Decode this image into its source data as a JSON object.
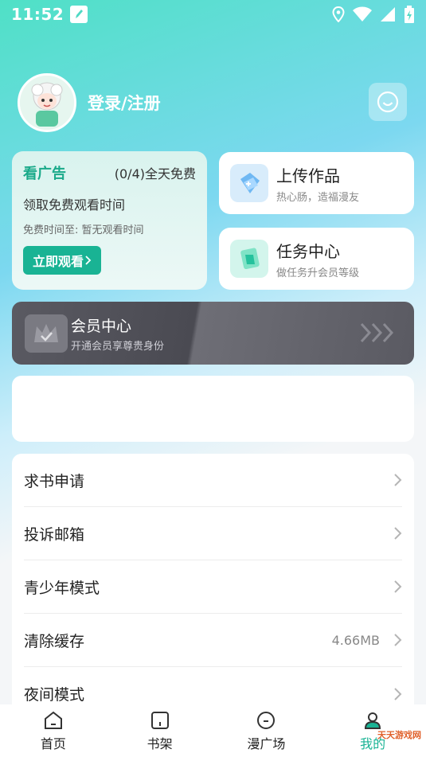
{
  "status_bar": {
    "time": "11:52"
  },
  "profile": {
    "login_label": "登录/注册",
    "avatar_badge": "小肥羊"
  },
  "ad_card": {
    "title": "看广告",
    "count": "(0/4)全天免费",
    "line1": "领取免费观看时间",
    "line2": "免费时间至: 暂无观看时间",
    "button": "立即观看"
  },
  "upload_card": {
    "title": "上传作品",
    "subtitle": "热心肠，造福漫友"
  },
  "task_card": {
    "title": "任务中心",
    "subtitle": "做任务升会员等级"
  },
  "vip_card": {
    "title": "会员中心",
    "subtitle": "开通会员享尊贵身份"
  },
  "menu": {
    "items": [
      {
        "label": "求书申请",
        "value": ""
      },
      {
        "label": "投诉邮箱",
        "value": ""
      },
      {
        "label": "青少年模式",
        "value": ""
      },
      {
        "label": "清除缓存",
        "value": "4.66MB"
      },
      {
        "label": "夜间模式",
        "value": ""
      }
    ]
  },
  "bottom_nav": {
    "items": [
      {
        "label": "首页",
        "icon": "home-icon"
      },
      {
        "label": "书架",
        "icon": "bookshelf-icon"
      },
      {
        "label": "漫广场",
        "icon": "plaza-icon"
      },
      {
        "label": "我的",
        "icon": "user-icon"
      }
    ],
    "active": "我的"
  },
  "watermark": "天天游戏网",
  "colors": {
    "accent": "#19b394",
    "vip_bg": "#4a4a52",
    "card_bg": "#ffffff"
  }
}
